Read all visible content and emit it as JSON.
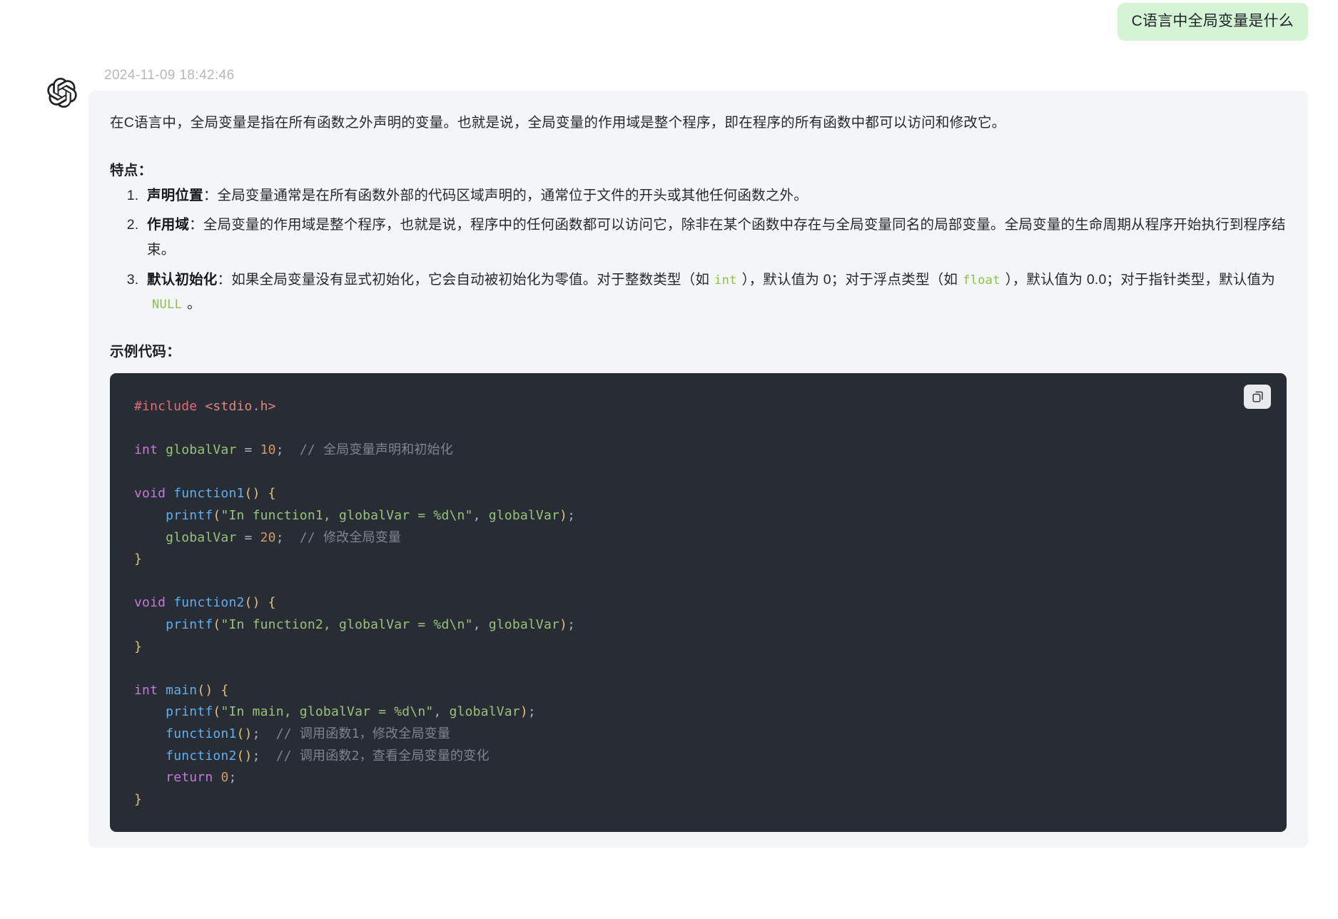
{
  "conversation": {
    "user_message": "C语言中全局变量是什么",
    "assistant": {
      "timestamp": "2024-11-09 18:42:46",
      "avatar_icon": "openai-logo-icon",
      "intro_paragraph": "在C语言中，全局变量是指在所有函数之外声明的变量。也就是说，全局变量的作用域是整个程序，即在程序的所有函数中都可以访问和修改它。",
      "features_heading": "特点：",
      "features": [
        {
          "term": "声明位置",
          "separator": "：",
          "text": "全局变量通常是在所有函数外部的代码区域声明的，通常位于文件的开头或其他任何函数之外。"
        },
        {
          "term": "作用域",
          "separator": "：",
          "text": "全局变量的作用域是整个程序，也就是说，程序中的任何函数都可以访问它，除非在某个函数中存在与全局变量同名的局部变量。全局变量的生命周期从程序开始执行到程序结束。"
        },
        {
          "term": "默认初始化",
          "separator": "：",
          "text_part1": "如果全局变量没有显式初始化，它会自动被初始化为零值。对于整数类型（如",
          "code1": "int",
          "text_part2": "），默认值为 0；对于浮点类型（如",
          "code2": "float",
          "text_part3": "），默认值为 0.0；对于指针类型，默认值为",
          "code3": "NULL",
          "text_part4": "。"
        }
      ],
      "code_heading": "示例代码：",
      "code_block": {
        "language": "c",
        "copy_button_icon": "copy-icon",
        "copy_button_label": "复制",
        "lines": [
          [
            {
              "t": "#include",
              "c": "t-pre"
            },
            {
              "t": " ",
              "c": "t-op"
            },
            {
              "t": "<stdio.h>",
              "c": "t-hdr"
            }
          ],
          [],
          [
            {
              "t": "int",
              "c": "t-kw"
            },
            {
              "t": " ",
              "c": "t-op"
            },
            {
              "t": "globalVar",
              "c": "t-var"
            },
            {
              "t": " = ",
              "c": "t-op"
            },
            {
              "t": "10",
              "c": "t-num"
            },
            {
              "t": ";",
              "c": "t-op"
            },
            {
              "t": "  ",
              "c": "t-op"
            },
            {
              "t": "// 全局变量声明和初始化",
              "c": "t-cmt"
            }
          ],
          [],
          [
            {
              "t": "void",
              "c": "t-kw"
            },
            {
              "t": " ",
              "c": "t-op"
            },
            {
              "t": "function1",
              "c": "t-fn"
            },
            {
              "t": "()",
              "c": "t-punc"
            },
            {
              "t": " ",
              "c": "t-op"
            },
            {
              "t": "{",
              "c": "t-punc"
            }
          ],
          [
            {
              "t": "    ",
              "c": "t-op"
            },
            {
              "t": "printf",
              "c": "t-fn"
            },
            {
              "t": "(",
              "c": "t-punc"
            },
            {
              "t": "\"In function1, globalVar = %d\\n\"",
              "c": "t-str"
            },
            {
              "t": ", ",
              "c": "t-op"
            },
            {
              "t": "globalVar",
              "c": "t-var"
            },
            {
              "t": ")",
              "c": "t-punc"
            },
            {
              "t": ";",
              "c": "t-op"
            }
          ],
          [
            {
              "t": "    ",
              "c": "t-op"
            },
            {
              "t": "globalVar",
              "c": "t-var"
            },
            {
              "t": " = ",
              "c": "t-op"
            },
            {
              "t": "20",
              "c": "t-num"
            },
            {
              "t": ";",
              "c": "t-op"
            },
            {
              "t": "  ",
              "c": "t-op"
            },
            {
              "t": "// 修改全局变量",
              "c": "t-cmt"
            }
          ],
          [
            {
              "t": "}",
              "c": "t-punc"
            }
          ],
          [],
          [
            {
              "t": "void",
              "c": "t-kw"
            },
            {
              "t": " ",
              "c": "t-op"
            },
            {
              "t": "function2",
              "c": "t-fn"
            },
            {
              "t": "()",
              "c": "t-punc"
            },
            {
              "t": " ",
              "c": "t-op"
            },
            {
              "t": "{",
              "c": "t-punc"
            }
          ],
          [
            {
              "t": "    ",
              "c": "t-op"
            },
            {
              "t": "printf",
              "c": "t-fn"
            },
            {
              "t": "(",
              "c": "t-punc"
            },
            {
              "t": "\"In function2, globalVar = %d\\n\"",
              "c": "t-str"
            },
            {
              "t": ", ",
              "c": "t-op"
            },
            {
              "t": "globalVar",
              "c": "t-var"
            },
            {
              "t": ")",
              "c": "t-punc"
            },
            {
              "t": ";",
              "c": "t-op"
            }
          ],
          [
            {
              "t": "}",
              "c": "t-punc"
            }
          ],
          [],
          [
            {
              "t": "int",
              "c": "t-kw"
            },
            {
              "t": " ",
              "c": "t-op"
            },
            {
              "t": "main",
              "c": "t-fn"
            },
            {
              "t": "()",
              "c": "t-punc"
            },
            {
              "t": " ",
              "c": "t-op"
            },
            {
              "t": "{",
              "c": "t-punc"
            }
          ],
          [
            {
              "t": "    ",
              "c": "t-op"
            },
            {
              "t": "printf",
              "c": "t-fn"
            },
            {
              "t": "(",
              "c": "t-punc"
            },
            {
              "t": "\"In main, globalVar = %d\\n\"",
              "c": "t-str"
            },
            {
              "t": ", ",
              "c": "t-op"
            },
            {
              "t": "globalVar",
              "c": "t-var"
            },
            {
              "t": ")",
              "c": "t-punc"
            },
            {
              "t": ";",
              "c": "t-op"
            }
          ],
          [
            {
              "t": "    ",
              "c": "t-op"
            },
            {
              "t": "function1",
              "c": "t-fn"
            },
            {
              "t": "()",
              "c": "t-punc"
            },
            {
              "t": ";",
              "c": "t-op"
            },
            {
              "t": "  ",
              "c": "t-op"
            },
            {
              "t": "// 调用函数1，修改全局变量",
              "c": "t-cmt"
            }
          ],
          [
            {
              "t": "    ",
              "c": "t-op"
            },
            {
              "t": "function2",
              "c": "t-fn"
            },
            {
              "t": "()",
              "c": "t-punc"
            },
            {
              "t": ";",
              "c": "t-op"
            },
            {
              "t": "  ",
              "c": "t-op"
            },
            {
              "t": "// 调用函数2，查看全局变量的变化",
              "c": "t-cmt"
            }
          ],
          [
            {
              "t": "    ",
              "c": "t-op"
            },
            {
              "t": "return",
              "c": "t-kw"
            },
            {
              "t": " ",
              "c": "t-op"
            },
            {
              "t": "0",
              "c": "t-num"
            },
            {
              "t": ";",
              "c": "t-op"
            }
          ],
          [
            {
              "t": "}",
              "c": "t-punc"
            }
          ]
        ]
      }
    }
  },
  "colors": {
    "user_bubble_bg": "#d4f4d4",
    "assistant_card_bg": "#f4f5f7",
    "code_bg": "#282c34",
    "timestamp": "#b5b8bd",
    "inline_code": "#8bc34a"
  }
}
